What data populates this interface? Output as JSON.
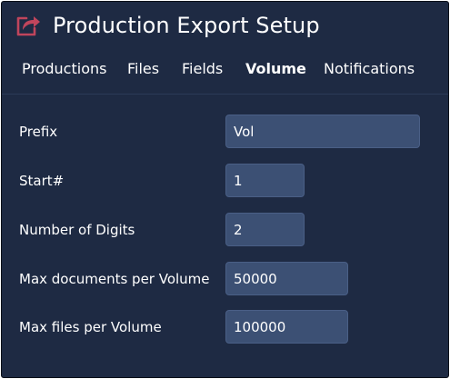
{
  "header": {
    "title": "Production Export Setup",
    "icon": "share-export-icon",
    "icon_color": "#c0455c"
  },
  "tabs": [
    {
      "label": "Productions",
      "active": false
    },
    {
      "label": "Files",
      "active": false
    },
    {
      "label": "Fields",
      "active": false
    },
    {
      "label": "Volume",
      "active": true
    },
    {
      "label": "Notifications",
      "active": false
    }
  ],
  "form": {
    "prefix": {
      "label": "Prefix",
      "value": "Vol"
    },
    "start": {
      "label": "Start#",
      "value": "1"
    },
    "digits": {
      "label": "Number of Digits",
      "value": "2"
    },
    "max_docs": {
      "label": "Max documents per Volume",
      "value": "50000"
    },
    "max_files": {
      "label": "Max files per Volume",
      "value": "100000"
    }
  },
  "colors": {
    "background": "#1e2a43",
    "field": "#3c5074",
    "text": "#ffffff"
  }
}
